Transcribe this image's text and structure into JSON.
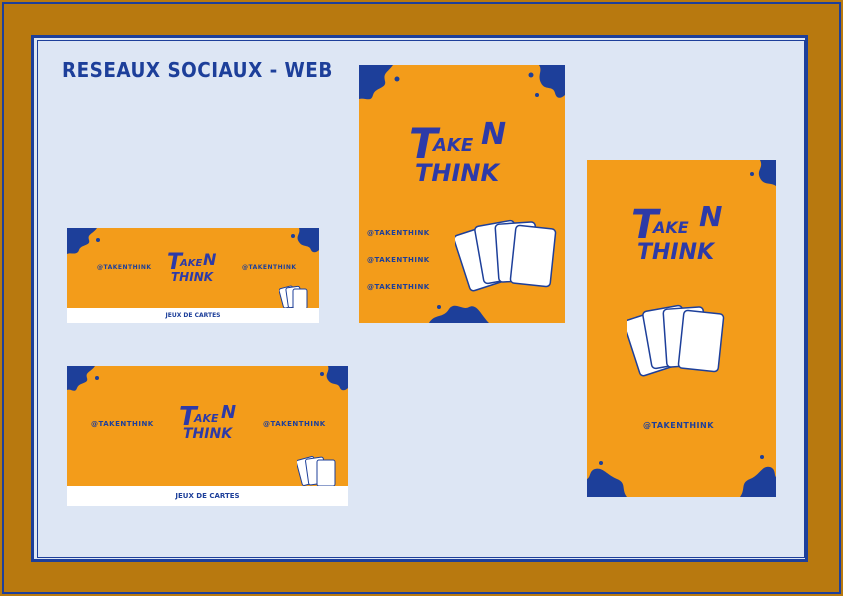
{
  "title": "RESEAUX SOCIAUX - WEB",
  "brand": {
    "logo_line1_a": "T",
    "logo_line1_b": "AKE",
    "logo_line1_c": "N",
    "logo_line2": "THINK"
  },
  "handle": "@TAKENTHINK",
  "footer_label": "JEUX DE CARTES",
  "colors": {
    "frame": "#b8790f",
    "board": "#dde6f4",
    "accent_blue": "#1d3f9a",
    "panel_orange": "#f39c1a",
    "logo_blue": "#2d3aa8"
  },
  "panels": {
    "banner_small": {
      "handle_left": "@TAKENTHINK",
      "handle_right": "@TAKENTHINK",
      "footer": "JEUX DE CARTES"
    },
    "banner_large": {
      "handle_left": "@TAKENTHINK",
      "handle_right": "@TAKENTHINK",
      "footer": "JEUX DE CARTES"
    },
    "post_square": {
      "handles": [
        "@TAKENTHINK",
        "@TAKENTHINK",
        "@TAKENTHINK"
      ]
    },
    "story": {
      "handle": "@TAKENTHINK"
    }
  },
  "icons": [
    "splash-icon",
    "playing-cards-icon",
    "logo-icon"
  ]
}
